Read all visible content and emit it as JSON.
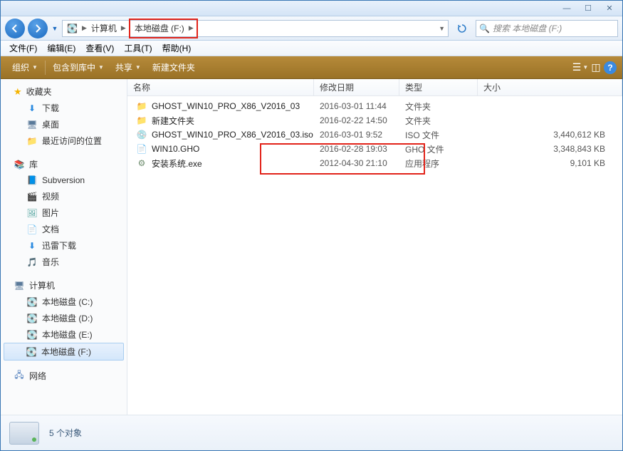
{
  "titlebar": {
    "min": "—",
    "max": "☐",
    "close": "✕"
  },
  "nav": {
    "back": "←",
    "fwd": "→",
    "breadcrumb": {
      "computer_icon": "🖥",
      "computer": "计算机",
      "drive": "本地磁盘 (F:)"
    },
    "refresh": "↻",
    "search_placeholder": "搜索 本地磁盘 (F:)"
  },
  "menu": {
    "file": "文件(F)",
    "edit": "编辑(E)",
    "view": "查看(V)",
    "tools": "工具(T)",
    "help": "帮助(H)"
  },
  "toolbar": {
    "organize": "组织",
    "include": "包含到库中",
    "share": "共享",
    "newfolder": "新建文件夹"
  },
  "columns": {
    "name": "名称",
    "date": "修改日期",
    "type": "类型",
    "size": "大小"
  },
  "sidebar": {
    "favorites": {
      "label": "收藏夹",
      "items": [
        {
          "icon": "⬇",
          "iconColor": "#2a8ae0",
          "label": "下载"
        },
        {
          "icon": "🖥",
          "iconColor": "#5a7a9a",
          "label": "桌面"
        },
        {
          "icon": "📁",
          "iconColor": "#8a6a3a",
          "label": "最近访问的位置"
        }
      ]
    },
    "libraries": {
      "label": "库",
      "items": [
        {
          "icon": "📘",
          "iconColor": "#5a8ac0",
          "label": "Subversion"
        },
        {
          "icon": "🎬",
          "iconColor": "#4a6a9a",
          "label": "视频"
        },
        {
          "icon": "🖼",
          "iconColor": "#4aa09a",
          "label": "图片"
        },
        {
          "icon": "📄",
          "iconColor": "#6a8aba",
          "label": "文档"
        },
        {
          "icon": "⬇",
          "iconColor": "#2a8ae0",
          "label": "迅雷下载"
        },
        {
          "icon": "🎵",
          "iconColor": "#3a9ae0",
          "label": "音乐"
        }
      ]
    },
    "computer": {
      "label": "计算机",
      "items": [
        {
          "icon": "💽",
          "iconColor": "#6a8aba",
          "label": "本地磁盘 (C:)",
          "sel": false
        },
        {
          "icon": "💽",
          "iconColor": "#8a9aaa",
          "label": "本地磁盘 (D:)",
          "sel": false
        },
        {
          "icon": "💽",
          "iconColor": "#8a9aaa",
          "label": "本地磁盘 (E:)",
          "sel": false
        },
        {
          "icon": "💽",
          "iconColor": "#8a9aaa",
          "label": "本地磁盘 (F:)",
          "sel": true
        }
      ]
    },
    "network": {
      "label": "网络"
    }
  },
  "files": [
    {
      "icon": "📁",
      "iconColor": "#f0c060",
      "name": "GHOST_WIN10_PRO_X86_V2016_03",
      "date": "2016-03-01 11:44",
      "type": "文件夹",
      "size": ""
    },
    {
      "icon": "📁",
      "iconColor": "#f0c060",
      "name": "新建文件夹",
      "date": "2016-02-22 14:50",
      "type": "文件夹",
      "size": ""
    },
    {
      "icon": "💿",
      "iconColor": "#b0b0b0",
      "name": "GHOST_WIN10_PRO_X86_V2016_03.iso",
      "date": "2016-03-01 9:52",
      "type": "ISO 文件",
      "size": "3,440,612 KB"
    },
    {
      "icon": "📄",
      "iconColor": "#e0e0e0",
      "name": "WIN10.GHO",
      "date": "2016-02-28 19:03",
      "type": "GHO 文件",
      "size": "3,348,843 KB"
    },
    {
      "icon": "⚙",
      "iconColor": "#6a8a6a",
      "name": "安装系统.exe",
      "date": "2012-04-30 21:10",
      "type": "应用程序",
      "size": "9,101 KB"
    }
  ],
  "status": {
    "count": "5 个对象"
  }
}
